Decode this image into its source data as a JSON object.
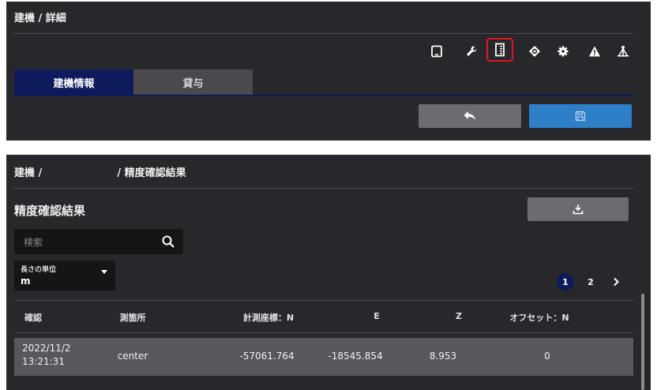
{
  "top_panel": {
    "breadcrumb": "建機 / 詳細",
    "tabs": [
      {
        "label": "建機情報",
        "active": true
      },
      {
        "label": "貸与",
        "active": false
      }
    ],
    "toolbar_icons": [
      "tablet-icon",
      "wrench-icon",
      "document-ruler-icon",
      "target-icon",
      "gear-icon",
      "warning-icon",
      "survey-icon"
    ],
    "selected_icon": "document-ruler-icon",
    "colors": {
      "accent_red": "#e0161e",
      "tab_active": "#0d1a5c",
      "save_blue": "#2f7fc8"
    }
  },
  "bottom_panel": {
    "breadcrumb": "建機 /                     / 精度確認結果",
    "title": "精度確認結果",
    "search": {
      "placeholder": "検索",
      "value": ""
    },
    "unit_select": {
      "label": "長さの単位",
      "value": "m"
    },
    "pagination": {
      "pages": [
        "1",
        "2"
      ],
      "current": "1"
    },
    "table": {
      "columns": [
        "確認",
        "測箇所",
        "計測座標：N",
        "E",
        "Z",
        "オフセット：N"
      ],
      "rows": [
        {
          "date": "2022/11/2",
          "time": "13:21:31",
          "location": "center",
          "n": "-57061.764",
          "e": "-18545.854",
          "z": "8.953",
          "offset_n": "0"
        }
      ]
    }
  }
}
